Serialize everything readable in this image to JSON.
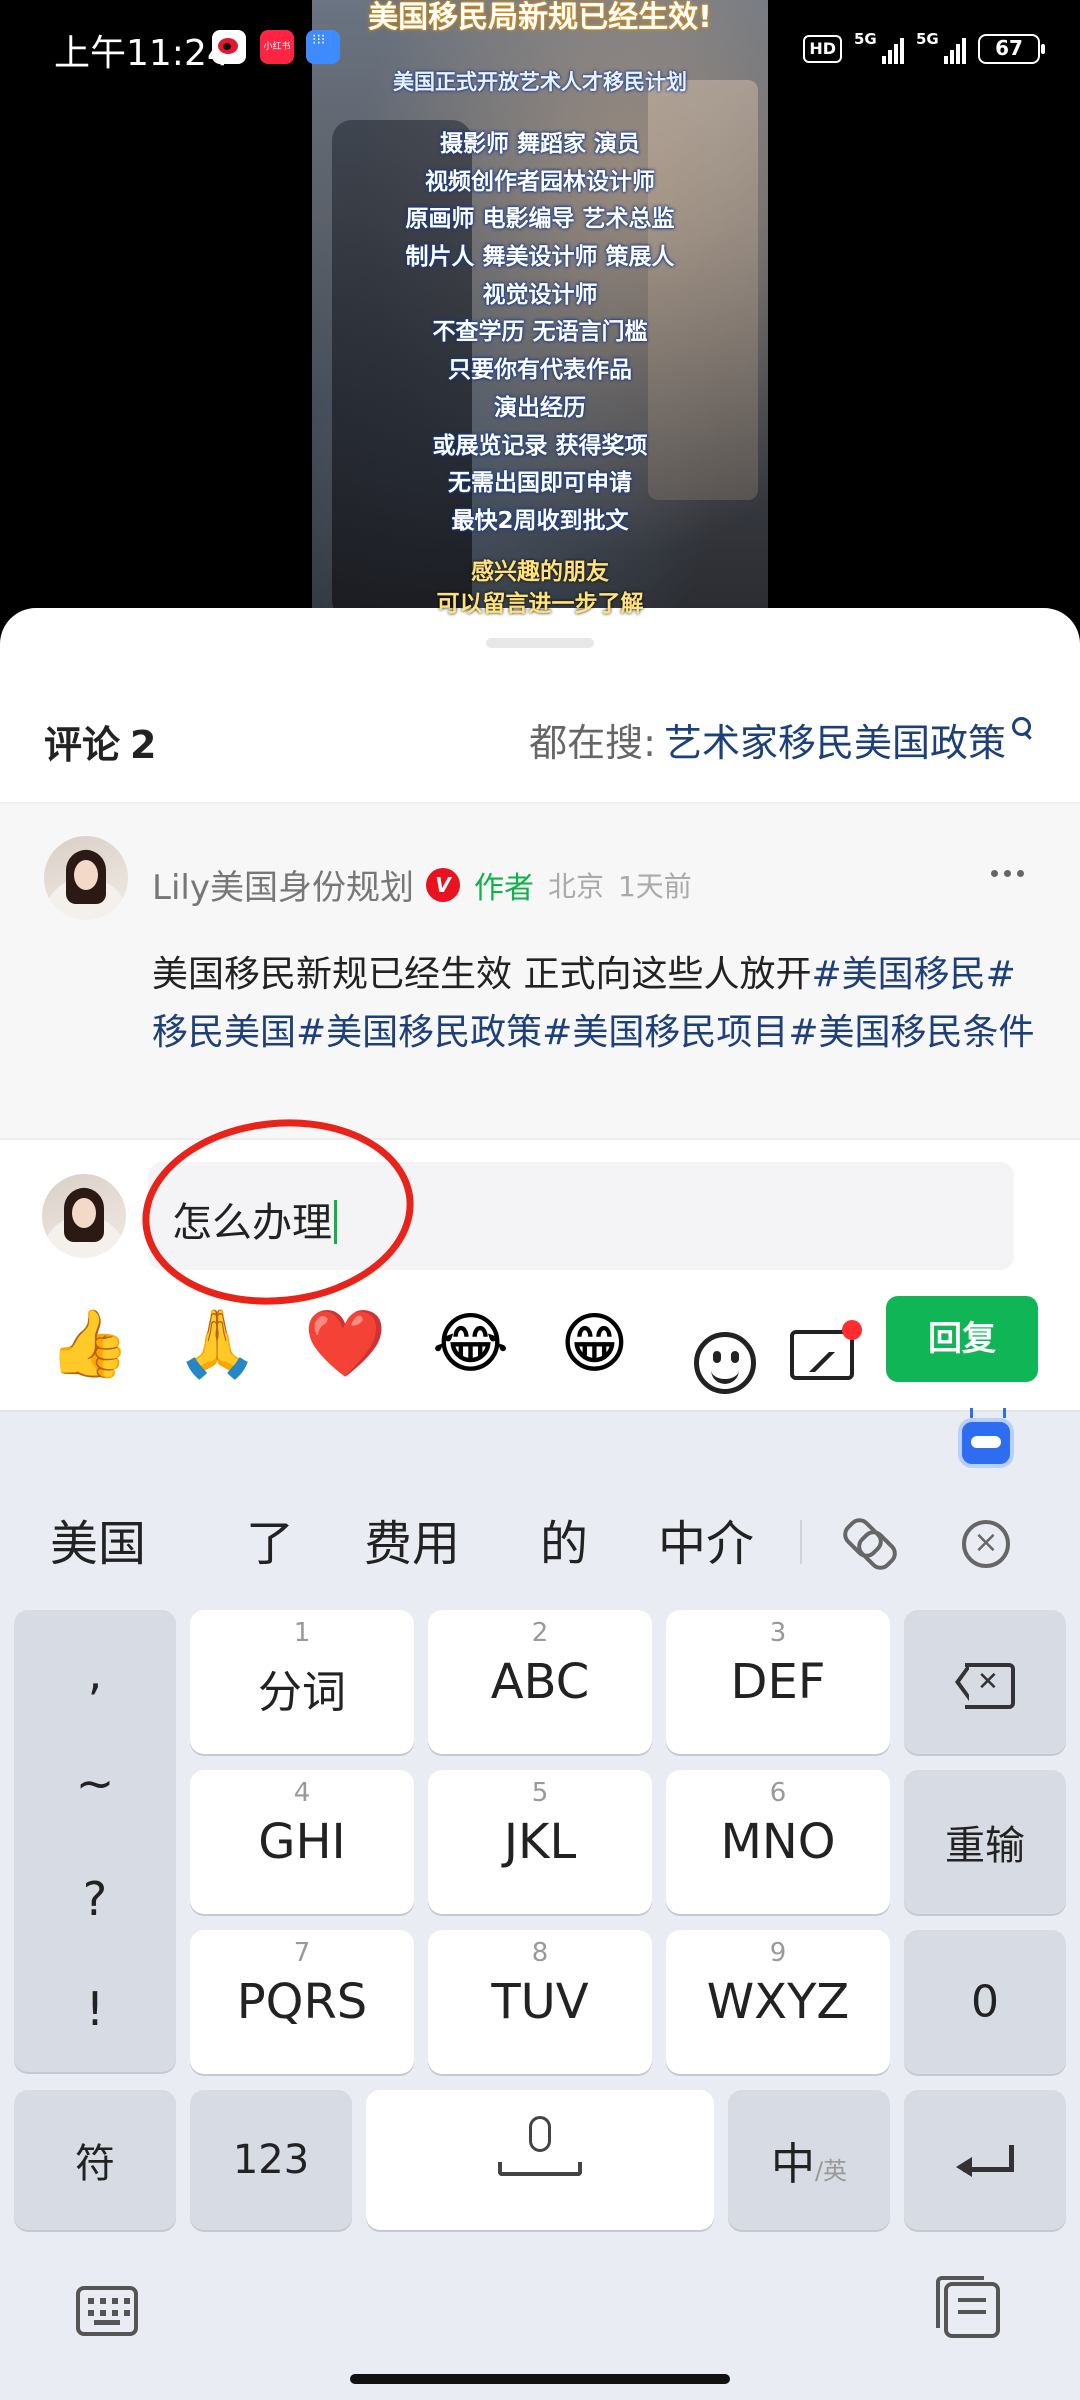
{
  "status_bar": {
    "time": "上午11:24",
    "notification_icons": [
      "weibo-icon",
      "xiaohongshu-icon",
      "app-grid-icon"
    ],
    "red_app_label": "小红书",
    "hd_badge": "HD",
    "signal_1_label": "5G",
    "signal_2_label": "5G",
    "battery": "67"
  },
  "video": {
    "title": "美国移民局新规已经生效!",
    "subtitle": "美国正式开放艺术人才移民计划",
    "lines": [
      "摄影师 舞蹈家 演员",
      "视频创作者园林设计师",
      "原画师 电影编导 艺术总监",
      "制片人 舞美设计师 策展人",
      "视觉设计师",
      "不查学历 无语言门槛",
      "只要你有代表作品",
      "演出经历",
      "或展览记录 获得奖项",
      "无需出国即可申请",
      "最快2周收到批文"
    ],
    "bottom_lines": [
      "感兴趣的朋友",
      "可以留言进一步了解"
    ]
  },
  "comments": {
    "header_label": "评论",
    "count": "2",
    "search_prefix": "都在搜:",
    "search_keyword": "艺术家移民美国政策",
    "item": {
      "username": "Lily美国身份规划",
      "verified_badge": "V",
      "author_tag": "作者",
      "location": "北京",
      "time": "1天前",
      "text": "美国移民新规已经生效 正式向这些人放开",
      "hashtags": "#美国移民#移民美国#美国移民政策#美国移民项目#美国移民条件"
    }
  },
  "reply": {
    "input_value": "怎么办理",
    "emojis": [
      "👍",
      "🙏",
      "❤️",
      "😂",
      "😁"
    ],
    "emoji_icons": [
      "smile-icon",
      "image-icon"
    ],
    "reply_button": "回复",
    "annotation_color": "#e8231a"
  },
  "keyboard": {
    "candidates": [
      "美国",
      "了",
      "费用",
      "的",
      "中介"
    ],
    "punctuation": [
      ",",
      "~",
      "?",
      "!"
    ],
    "keys": [
      {
        "num": "1",
        "label": "分词"
      },
      {
        "num": "2",
        "label": "ABC"
      },
      {
        "num": "3",
        "label": "DEF"
      },
      {
        "num": "4",
        "label": "GHI"
      },
      {
        "num": "5",
        "label": "JKL"
      },
      {
        "num": "6",
        "label": "MNO"
      },
      {
        "num": "7",
        "label": "PQRS"
      },
      {
        "num": "8",
        "label": "TUV"
      },
      {
        "num": "9",
        "label": "WXYZ"
      }
    ],
    "reinput": "重输",
    "zero": "0",
    "symbols": "符",
    "numbers": "123",
    "lang_main": "中",
    "lang_alt": "/英"
  },
  "colors": {
    "accent_green": "#10b656",
    "hashtag_blue": "#1d3f7a",
    "verified_red": "#e8131f"
  }
}
